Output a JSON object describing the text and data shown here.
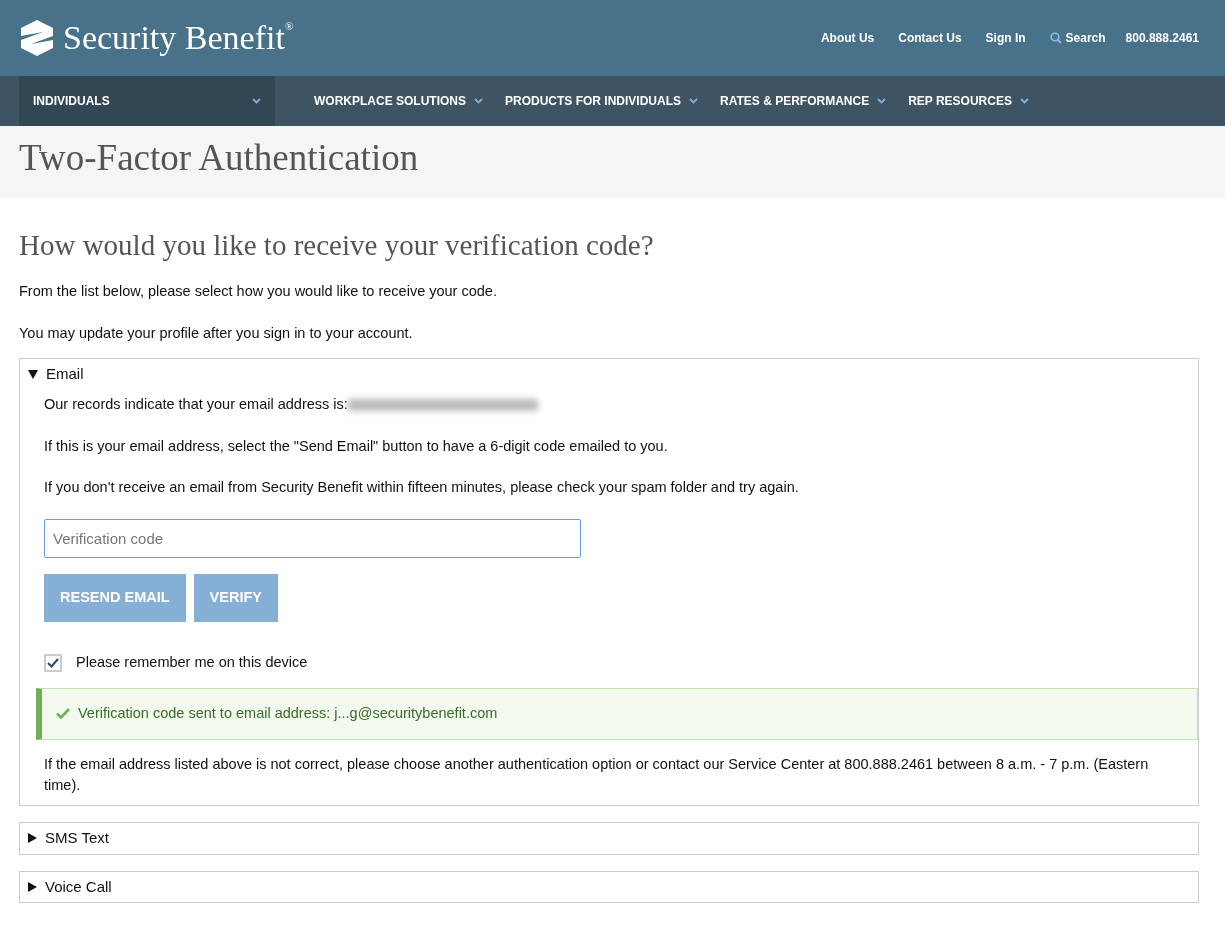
{
  "header": {
    "logo_text": "Security Benefit",
    "logo_mark": "®",
    "links": [
      "About Us",
      "Contact Us",
      "Sign In"
    ],
    "search": "Search",
    "phone": "800.888.2461"
  },
  "nav": {
    "audience": {
      "label": "INDIVIDUALS"
    },
    "items": [
      {
        "label": "WORKPLACE SOLUTIONS"
      },
      {
        "label": "PRODUCTS FOR INDIVIDUALS"
      },
      {
        "label": "RATES & PERFORMANCE"
      },
      {
        "label": "REP RESOURCES"
      }
    ]
  },
  "page_title": "Two-Factor Authentication",
  "heading": "How would you like to receive your verification code?",
  "intro": [
    "From the list below, please select how you would like to receive your code.",
    "You may update your profile after you sign in to your account."
  ],
  "sections": [
    {
      "label": "Email",
      "expanded": true,
      "records_text": "Our records indicate that your email address is:",
      "paragraphs": [
        "If this is your email address, select the \"Send Email\" button to have a 6-digit code emailed to you.",
        "If you don't receive an email from Security Benefit within fifteen minutes, please check your spam folder and try again."
      ],
      "code_field": {
        "placeholder": "Verification code"
      },
      "buttons": [
        {
          "label": "RESEND EMAIL",
          "disabled": true
        },
        {
          "label": "VERIFY",
          "disabled": true
        }
      ],
      "remember": {
        "label": "Please remember me on this device",
        "checked": true
      },
      "alert": "Verification code sent to email address: j...g@securitybenefit.com",
      "footer_note": "If the email address listed above is not correct, please choose another authentication option or contact our Service Center at 800.888.2461 between 8 a.m. - 7 p.m. (Eastern time)."
    },
    {
      "label": "SMS Text",
      "expanded": false
    },
    {
      "label": "Voice Call",
      "expanded": false
    }
  ]
}
